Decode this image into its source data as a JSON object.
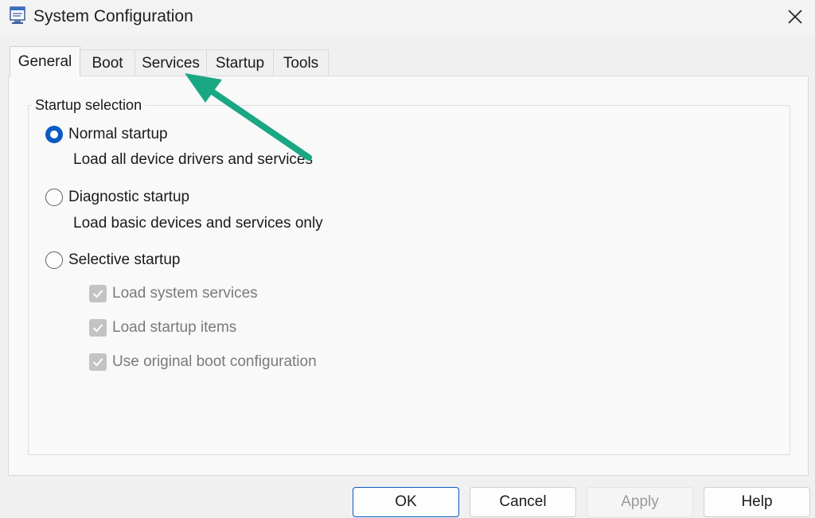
{
  "window": {
    "title": "System Configuration",
    "app_icon": "msconfig-icon",
    "close_icon": "close-icon"
  },
  "tabs": [
    {
      "label": "General",
      "active": true
    },
    {
      "label": "Boot",
      "active": false
    },
    {
      "label": "Services",
      "active": false
    },
    {
      "label": "Startup",
      "active": false
    },
    {
      "label": "Tools",
      "active": false
    }
  ],
  "startup_selection": {
    "legend": "Startup selection",
    "options": [
      {
        "label": "Normal startup",
        "description": "Load all device drivers and services",
        "selected": true
      },
      {
        "label": "Diagnostic startup",
        "description": "Load basic devices and services only",
        "selected": false
      },
      {
        "label": "Selective startup",
        "selected": false
      }
    ],
    "selective_options": [
      {
        "label": "Load system services",
        "checked": true,
        "enabled": false
      },
      {
        "label": "Load startup items",
        "checked": true,
        "enabled": false
      },
      {
        "label": "Use original boot configuration",
        "checked": true,
        "enabled": false
      }
    ]
  },
  "annotation": {
    "arrow_color": "#1aa784",
    "target": "Services"
  },
  "buttons": {
    "ok": "OK",
    "cancel": "Cancel",
    "apply": "Apply",
    "help": "Help"
  },
  "colors": {
    "accent": "#0a5bc4",
    "window_bg": "#f0f0f0",
    "panel_bg": "#f9f9f9"
  }
}
